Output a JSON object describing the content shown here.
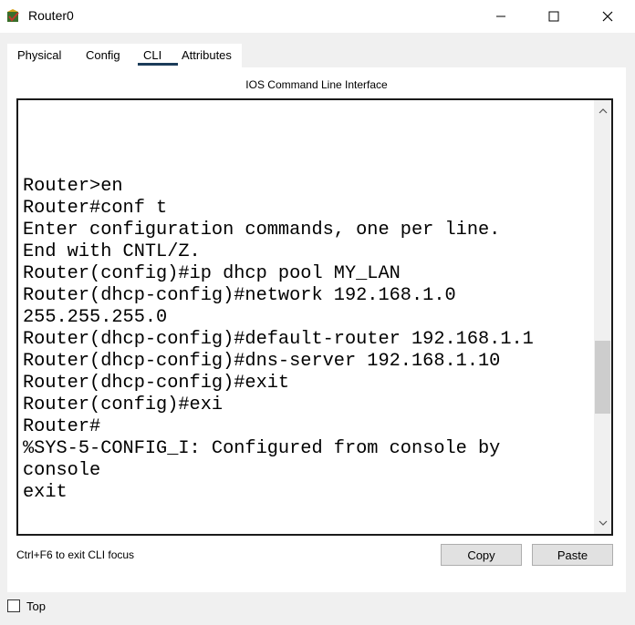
{
  "window": {
    "title": "Router0",
    "controls": [
      "minimize",
      "maximize",
      "close"
    ]
  },
  "tabs": [
    {
      "label": "Physical",
      "active": false
    },
    {
      "label": "Config",
      "active": false
    },
    {
      "label": "CLI",
      "active": true
    },
    {
      "label": "Attributes",
      "active": false
    }
  ],
  "cli": {
    "header": "IOS Command Line Interface",
    "lines": [
      "",
      "",
      "",
      "",
      "Router>en",
      "Router#conf t",
      "Enter configuration commands, one per line.",
      "End with CNTL/Z.",
      "Router(config)#ip dhcp pool MY_LAN",
      "Router(dhcp-config)#network 192.168.1.0",
      "255.255.255.0",
      "Router(dhcp-config)#default-router 192.168.1.1",
      "Router(dhcp-config)#dns-server 192.168.1.10",
      "Router(dhcp-config)#exit",
      "Router(config)#exi",
      "Router#",
      "%SYS-5-CONFIG_I: Configured from console by",
      "console",
      "exit"
    ],
    "scroll_position": 0.62
  },
  "footer": {
    "hint": "Ctrl+F6 to exit CLI focus",
    "copy_label": "Copy",
    "paste_label": "Paste"
  },
  "top": {
    "label": "Top",
    "checked": false
  }
}
